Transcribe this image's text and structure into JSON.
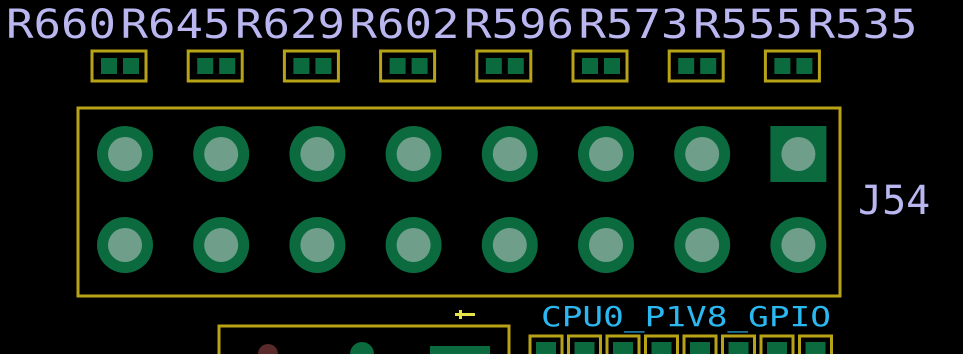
{
  "board": {
    "background": "#000000",
    "colors": {
      "silkscreen": "#b9b6f0",
      "outline": "#b8a317",
      "pad": "#0b6a3e",
      "drill": "#6f9e8a",
      "net_label": "#2bb7f0",
      "marker": "#e6e24a"
    }
  },
  "resistors": [
    {
      "ref": "R660"
    },
    {
      "ref": "R645"
    },
    {
      "ref": "R629"
    },
    {
      "ref": "R602"
    },
    {
      "ref": "R596"
    },
    {
      "ref": "R573"
    },
    {
      "ref": "R555"
    },
    {
      "ref": "R535"
    }
  ],
  "connector": {
    "ref": "J54",
    "rows": 2,
    "columns": 8,
    "square_pad": {
      "row": 1,
      "column": 8
    }
  },
  "net_label": "CPU0_P1V8_GPIO",
  "pin1_marker": "1"
}
